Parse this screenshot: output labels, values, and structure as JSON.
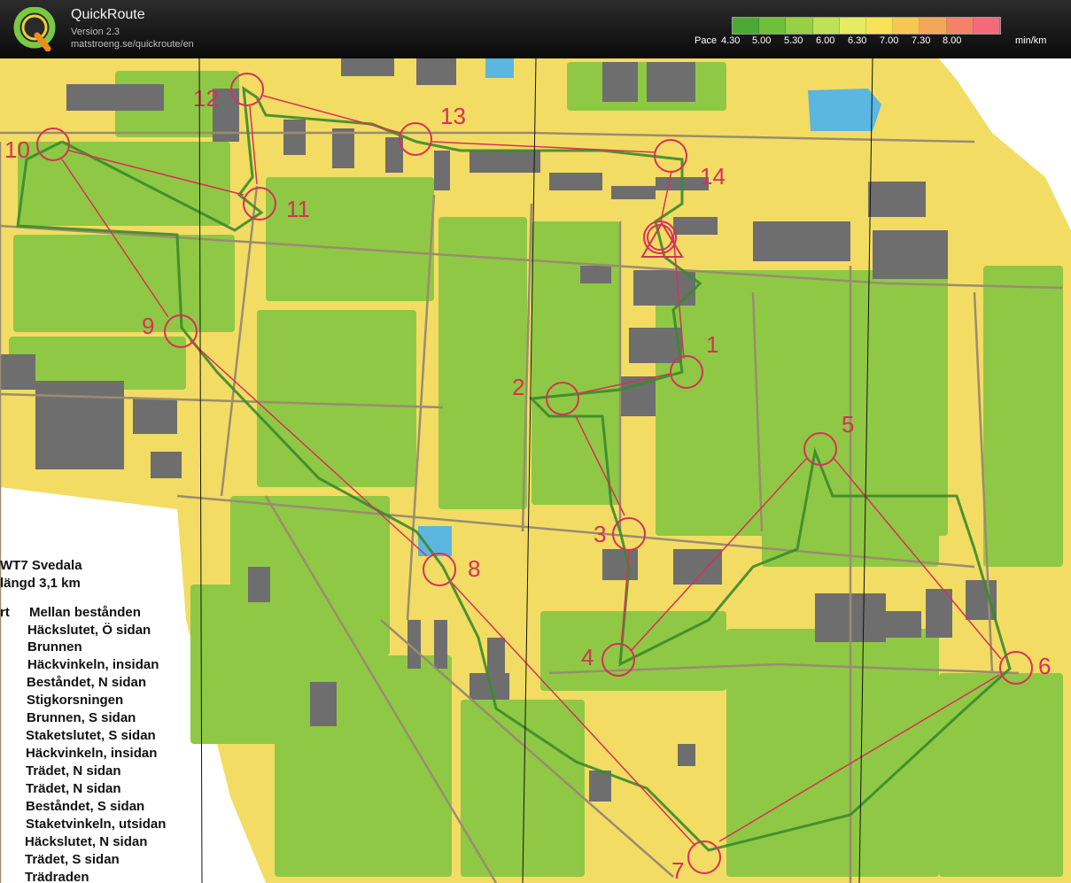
{
  "app": {
    "title": "QuickRoute",
    "version": "Version 2.3",
    "url": "matstroeng.se/quickroute/en",
    "logo_letter": "Q"
  },
  "pace": {
    "label": "Pace",
    "ticks": [
      "4.30",
      "5.00",
      "5.30",
      "6.00",
      "6.30",
      "7.00",
      "7.30",
      "8.00"
    ],
    "unit": "min/km",
    "colors": [
      "#4aaa34",
      "#6fbf3b",
      "#95d046",
      "#bfe059",
      "#e6ec62",
      "#f8e25a",
      "#f7c655",
      "#f5a55a",
      "#f38268",
      "#f36a7a"
    ]
  },
  "map": {
    "control_labels": [
      "1",
      "2",
      "3",
      "4",
      "5",
      "6",
      "7",
      "8",
      "9",
      "10",
      "11",
      "12",
      "13",
      "14"
    ],
    "colors": {
      "open": "#8fc844",
      "paved": "#f3dc63",
      "building": "#6e6e6e",
      "water": "#5bb6e0",
      "course": "#d8305a",
      "route": "#3a8a2e"
    }
  },
  "legend": {
    "title": "WT7 Svedala",
    "length": "längd 3,1 km",
    "start_label": "rt",
    "descriptions": [
      "Mellan bestånden",
      "Häckslutet, Ö sidan",
      "Brunnen",
      "Häckvinkeln, insidan",
      "Beståndet, N sidan",
      "Stigkorsningen",
      "Brunnen, S sidan",
      "Staketslutet, S sidan",
      "Häckvinkeln, insidan",
      "Trädet, N sidan",
      "Trädet, N sidan",
      "Beståndet, S sidan",
      "Staketvinkeln, utsidan",
      "Häckslutet, N sidan",
      "Trädet, S sidan",
      "Trädraden"
    ]
  }
}
